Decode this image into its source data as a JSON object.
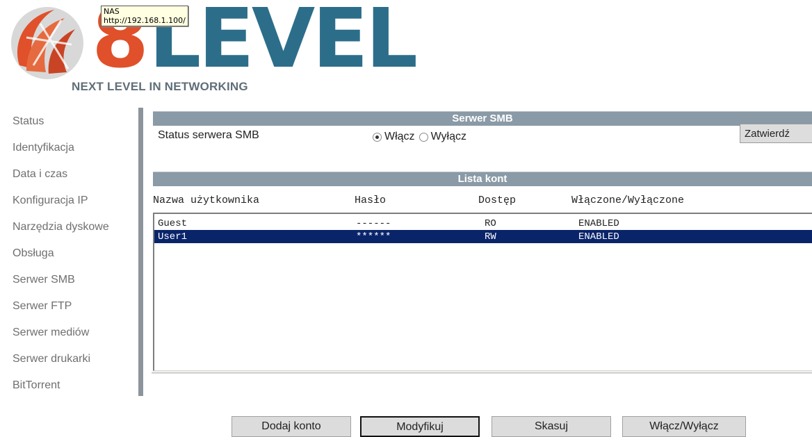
{
  "brand": {
    "logo_number": "8",
    "logo_word": "LEVEL",
    "tagline": "NEXT LEVEL IN NETWORKING",
    "brand_colors": {
      "orange": "#e0502a",
      "blue": "#2c6e8a"
    }
  },
  "tooltip": {
    "title": "NAS",
    "url": "http://192.168.1.100/"
  },
  "sidebar": {
    "items": [
      {
        "label": "Status"
      },
      {
        "label": "Identyfikacja"
      },
      {
        "label": "Data i czas"
      },
      {
        "label": "Konfiguracja IP"
      },
      {
        "label": "Narzędzia dyskowe"
      },
      {
        "label": "Obsługa"
      },
      {
        "label": "Serwer SMB"
      },
      {
        "label": "Serwer FTP"
      },
      {
        "label": "Serwer mediów"
      },
      {
        "label": "Serwer drukarki"
      },
      {
        "label": "BitTorrent"
      }
    ]
  },
  "smb": {
    "header": "Serwer SMB",
    "status_label": "Status serwera SMB",
    "option_on": "Włącz",
    "option_off": "Wyłącz",
    "selected": "Włącz",
    "submit_label": "Zatwierdź"
  },
  "accounts": {
    "header": "Lista kont",
    "columns": {
      "username": "Nazwa użytkownika",
      "password": "Hasło",
      "access": "Dostęp",
      "enabled": "Włączone/Wyłączone"
    },
    "rows": [
      {
        "username": "Guest",
        "password": "------",
        "access": "RO",
        "status": "ENABLED",
        "selected": false
      },
      {
        "username": "User1",
        "password": "******",
        "access": "RW",
        "status": "ENABLED",
        "selected": true
      }
    ],
    "selection_color": "#0a246a"
  },
  "actions": {
    "add": "Dodaj konto",
    "modify": "Modyfikuj",
    "delete": "Skasuj",
    "toggle": "Włącz/Wyłącz"
  },
  "colors": {
    "header_bar": "#8a9aa6",
    "sidebar_text": "#6f6f6f",
    "sidebar_divider": "#8c959c"
  }
}
